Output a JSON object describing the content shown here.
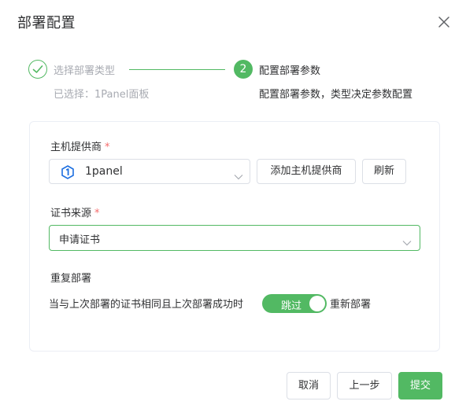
{
  "dialog": {
    "title": "部署配置"
  },
  "steps": [
    {
      "title": "选择部署类型",
      "desc": "已选择：1Panel面板",
      "status": "finished"
    },
    {
      "number": "2",
      "title": "配置部署参数",
      "desc": "配置部署参数，类型决定参数配置",
      "status": "active"
    }
  ],
  "form": {
    "provider": {
      "label": "主机提供商",
      "required_mark": "*",
      "value": "1panel",
      "icon": "1panel-logo-icon",
      "add_button": "添加主机提供商",
      "refresh_button": "刷新"
    },
    "cert_source": {
      "label": "证书来源",
      "required_mark": "*",
      "value": "申请证书"
    },
    "repeat_deploy": {
      "label": "重复部署",
      "description": "当与上次部署的证书相同且上次部署成功时",
      "switch_active_text": "跳过",
      "switch_inactive_text": "重新部署",
      "enabled": true
    }
  },
  "footer": {
    "cancel": "取消",
    "prev": "上一步",
    "submit": "提交"
  },
  "colors": {
    "primary": "#52b963",
    "required": "#f56c6c",
    "muted": "#a8abb2",
    "border": "#dcdfe6"
  }
}
